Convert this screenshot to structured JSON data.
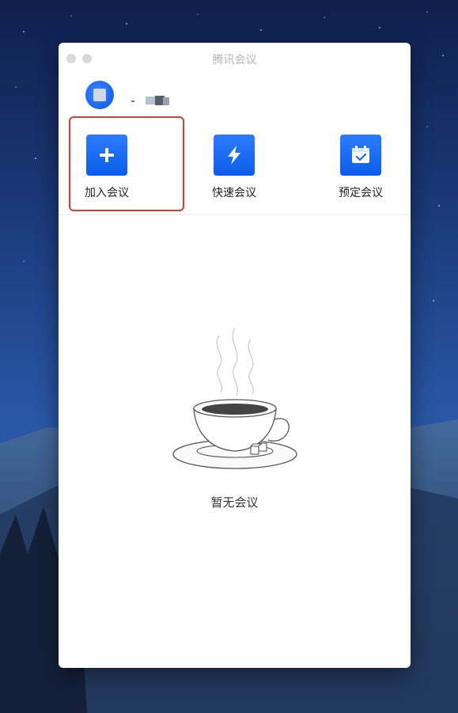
{
  "window": {
    "title": "腾讯会议"
  },
  "actions": [
    {
      "label": "加入会议",
      "icon": "plus-icon"
    },
    {
      "label": "快速会议",
      "icon": "lightning-icon"
    },
    {
      "label": "预定会议",
      "icon": "calendar-check-icon"
    }
  ],
  "empty_state": {
    "text": "暂无会议",
    "illustration": "coffee-cup-illustration"
  },
  "colors": {
    "accent": "#1469f2",
    "highlight": "#e03a2c"
  }
}
